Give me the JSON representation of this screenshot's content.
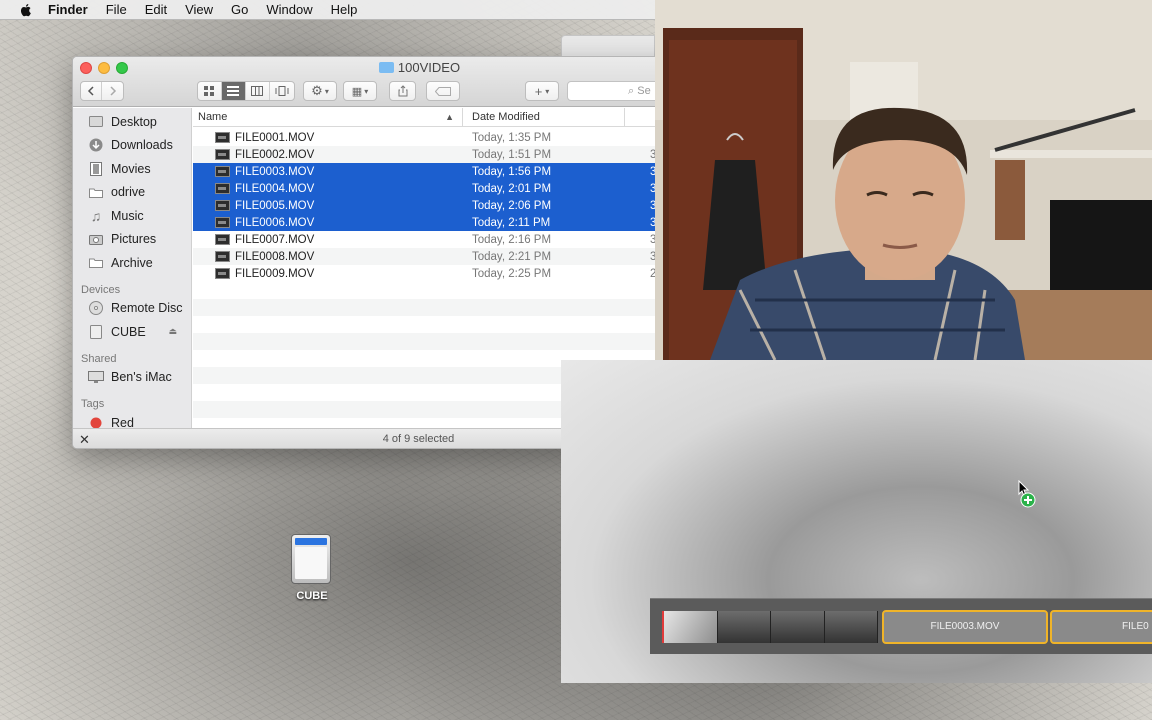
{
  "menubar": {
    "app_name": "Finder",
    "items": [
      "File",
      "Edit",
      "View",
      "Go",
      "Window",
      "Help"
    ]
  },
  "finder": {
    "title": "100VIDEO",
    "search_placeholder": "Se",
    "sidebar": {
      "favorites": [
        {
          "label": "Desktop",
          "icon": "desktop-icon"
        },
        {
          "label": "Downloads",
          "icon": "downloads-icon"
        },
        {
          "label": "Movies",
          "icon": "movies-icon"
        },
        {
          "label": "odrive",
          "icon": "folder-icon"
        },
        {
          "label": "Music",
          "icon": "music-icon"
        },
        {
          "label": "Pictures",
          "icon": "pictures-icon"
        },
        {
          "label": "Archive",
          "icon": "folder-icon"
        }
      ],
      "devices_header": "Devices",
      "devices": [
        {
          "label": "Remote Disc",
          "icon": "disc-icon"
        },
        {
          "label": "CUBE",
          "icon": "drive-icon"
        }
      ],
      "shared_header": "Shared",
      "shared": [
        {
          "label": "Ben's iMac",
          "icon": "imac-icon"
        }
      ],
      "tags_header": "Tags",
      "tags": [
        {
          "label": "Red",
          "color": "#e2453c"
        }
      ]
    },
    "columns": {
      "name": "Name",
      "date": "Date Modified"
    },
    "files": [
      {
        "name": "FILE0001.MOV",
        "date": "Today, 1:35 PM",
        "size": "",
        "selected": false
      },
      {
        "name": "FILE0002.MOV",
        "date": "Today, 1:51 PM",
        "size": "3",
        "selected": false
      },
      {
        "name": "FILE0003.MOV",
        "date": "Today, 1:56 PM",
        "size": "3",
        "selected": true
      },
      {
        "name": "FILE0004.MOV",
        "date": "Today, 2:01 PM",
        "size": "3",
        "selected": true
      },
      {
        "name": "FILE0005.MOV",
        "date": "Today, 2:06 PM",
        "size": "3",
        "selected": true
      },
      {
        "name": "FILE0006.MOV",
        "date": "Today, 2:11 PM",
        "size": "3",
        "selected": true
      },
      {
        "name": "FILE0007.MOV",
        "date": "Today, 2:16 PM",
        "size": "3",
        "selected": false
      },
      {
        "name": "FILE0008.MOV",
        "date": "Today, 2:21 PM",
        "size": "3",
        "selected": false
      },
      {
        "name": "FILE0009.MOV",
        "date": "Today, 2:25 PM",
        "size": "2",
        "selected": false
      }
    ],
    "status": "4 of 9 selected"
  },
  "timeline": {
    "clips": [
      "FILE0003.MOV",
      "FILE0"
    ]
  },
  "desktop": {
    "icon_label": "CUBE"
  },
  "colors": {
    "selection": "#1c5fcf",
    "clip_border": "#f0b429"
  }
}
